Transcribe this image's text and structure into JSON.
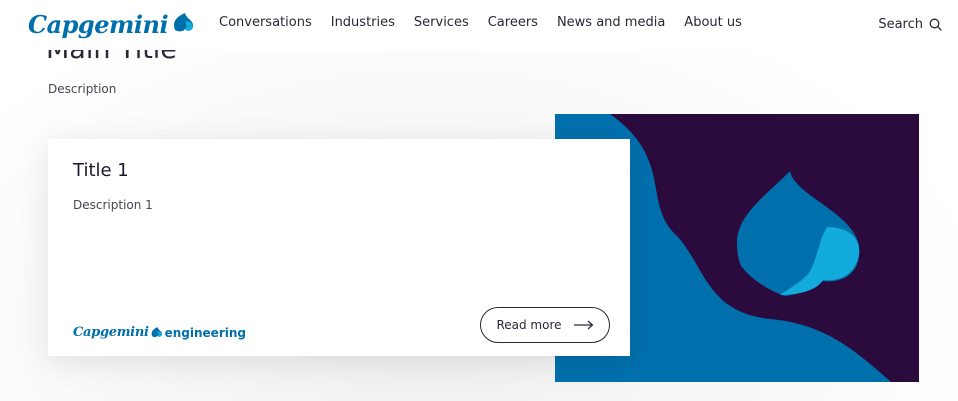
{
  "header": {
    "logo_text": "Capgemini",
    "nav": [
      "Conversations",
      "Industries",
      "Services",
      "Careers",
      "News and media",
      "About us"
    ],
    "search_label": "Search"
  },
  "section": {
    "title": "Main Title",
    "description": "Description"
  },
  "card": {
    "title": "Title 1",
    "description": "Description 1",
    "brand_name": "Capgemini",
    "brand_suffix": "engineering",
    "cta_label": "Read more"
  },
  "colors": {
    "brand_blue": "#0070ad",
    "light_blue": "#12abdb",
    "deep_purple": "#2b0a3d"
  }
}
